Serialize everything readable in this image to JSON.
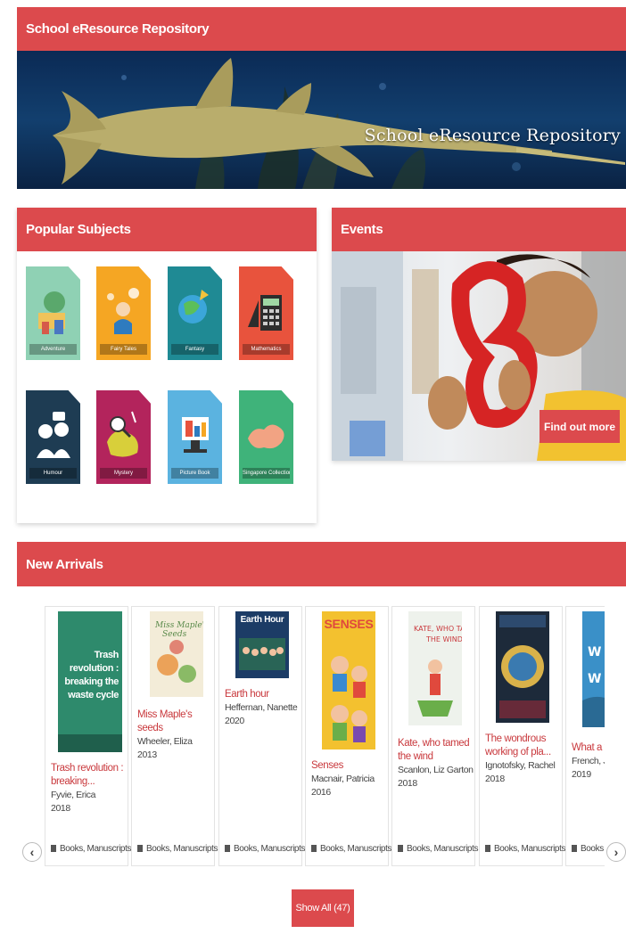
{
  "header": {
    "title": "School eResource Repository"
  },
  "banner": {
    "title": "School eResource Repository"
  },
  "popular": {
    "title": "Popular Subjects",
    "subjects": [
      {
        "label": "Adventure",
        "color": "#8fd1b4"
      },
      {
        "label": "Fairy Tales",
        "color": "#f5a623"
      },
      {
        "label": "Fantasy",
        "color": "#1f8a94"
      },
      {
        "label": "Mathematics",
        "color": "#e8533d"
      },
      {
        "label": "Humour",
        "color": "#1e3c53"
      },
      {
        "label": "Mystery",
        "color": "#b3245c"
      },
      {
        "label": "Picture Book",
        "color": "#5bb3e0"
      },
      {
        "label": "Singapore Collection",
        "color": "#3fb37a"
      }
    ]
  },
  "events": {
    "title": "Events",
    "button_label": "Find out more"
  },
  "arrivals": {
    "title": "New Arrivals",
    "books": [
      {
        "cover_text": "Trash revolution : breaking the waste cycle",
        "title": "Trash revolution : breaking...",
        "author": "Fyvie, Erica",
        "year": "2018",
        "format": "Books, Manuscripts"
      },
      {
        "cover_text": "",
        "title": "Miss Maple's seeds",
        "author": "Wheeler, Eliza",
        "year": "2013",
        "format": "Books, Manuscripts"
      },
      {
        "cover_text": "Earth Hour",
        "title": "Earth hour",
        "author": "Heffernan, Nanette",
        "year": "2020",
        "format": "Books, Manuscripts"
      },
      {
        "cover_text": "SENSES",
        "title": "Senses",
        "author": "Macnair, Patricia",
        "year": "2016",
        "format": "Books, Manuscripts"
      },
      {
        "cover_text": "",
        "title": "Kate, who tamed the wind",
        "author": "Scanlon, Liz Garton",
        "year": "2018",
        "format": "Books, Manuscripts"
      },
      {
        "cover_text": "",
        "title": "The wondrous working of pla...",
        "author": "Ignotofsky, Rachel",
        "year": "2018",
        "format": "Books, Manuscripts"
      },
      {
        "cover_text": "",
        "title": "What a w",
        "author": "French, Je",
        "year": "2019",
        "format": "Books"
      }
    ],
    "show_all_label": "Show All (47)"
  },
  "colors": {
    "accent": "#dc4a4d"
  },
  "icons": {
    "prev": "chevron-left-icon",
    "next": "chevron-right-icon",
    "format": "book-icon"
  }
}
